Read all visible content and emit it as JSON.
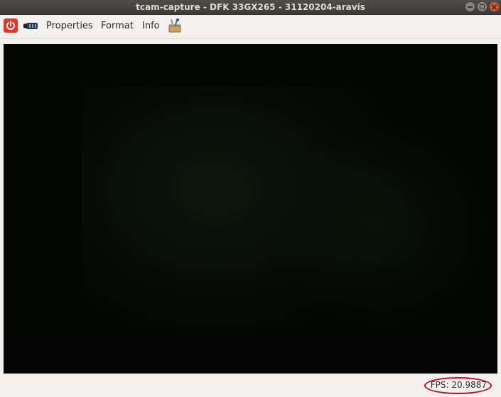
{
  "window": {
    "title": "tcam-capture - DFK 33GX265 - 31120204-aravis",
    "controls": [
      "minimize-icon",
      "maximize-icon",
      "close-icon"
    ]
  },
  "toolbar": {
    "icons": {
      "power": "power-icon",
      "camera": "camera-icon",
      "tools": "tools-icon"
    },
    "properties_label": "Properties",
    "format_label": "Format",
    "info_label": "Info"
  },
  "video": {
    "content": "live-camera-feed"
  },
  "status": {
    "fps_text": "FPS: 20.9887"
  },
  "colors": {
    "accent_close": "#e95420",
    "power_button": "#df382c",
    "highlight_annotation": "#d0021b"
  }
}
